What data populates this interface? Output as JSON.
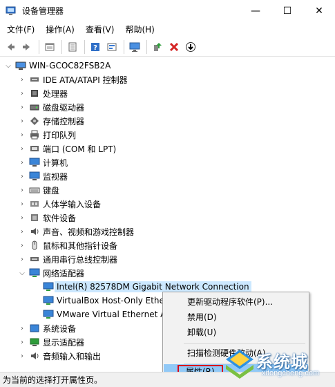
{
  "window": {
    "title": "设备管理器",
    "minimize": "—",
    "maximize": "☐",
    "close": "✕"
  },
  "menu": [
    "文件(F)",
    "操作(A)",
    "查看(V)",
    "帮助(H)"
  ],
  "toolbar": [
    "back-icon",
    "forward-icon",
    "sep",
    "view-icon",
    "sep",
    "properties-icon",
    "sep",
    "help-icon",
    "action-icon",
    "sep",
    "monitor-icon",
    "sep",
    "update-driver-icon",
    "remove-icon",
    "download-icon"
  ],
  "tree": {
    "root": "WIN-GCOC82FSB2A",
    "categories": [
      {
        "label": "IDE ATA/ATAPI 控制器",
        "icon": "ide-icon",
        "expanded": false
      },
      {
        "label": "处理器",
        "icon": "cpu-icon",
        "expanded": false
      },
      {
        "label": "磁盘驱动器",
        "icon": "disk-icon",
        "expanded": false
      },
      {
        "label": "存储控制器",
        "icon": "storage-icon",
        "expanded": false
      },
      {
        "label": "打印队列",
        "icon": "printer-icon",
        "expanded": false
      },
      {
        "label": "端口 (COM 和 LPT)",
        "icon": "port-icon",
        "expanded": false
      },
      {
        "label": "计算机",
        "icon": "computer-icon",
        "expanded": false
      },
      {
        "label": "监视器",
        "icon": "monitor-icon",
        "expanded": false
      },
      {
        "label": "键盘",
        "icon": "keyboard-icon",
        "expanded": false
      },
      {
        "label": "人体学输入设备",
        "icon": "hid-icon",
        "expanded": false
      },
      {
        "label": "软件设备",
        "icon": "software-icon",
        "expanded": false
      },
      {
        "label": "声音、视频和游戏控制器",
        "icon": "sound-icon",
        "expanded": false
      },
      {
        "label": "鼠标和其他指针设备",
        "icon": "mouse-icon",
        "expanded": false
      },
      {
        "label": "通用串行总线控制器",
        "icon": "usb-icon",
        "expanded": false
      },
      {
        "label": "网络适配器",
        "icon": "network-icon",
        "expanded": true
      }
    ],
    "network_children": [
      "Intel(R) 82578DM Gigabit Network Connection",
      "VirtualBox Host-Only Ethe",
      "VMware Virtual Ethernet A"
    ],
    "after": [
      {
        "label": "系统设备",
        "icon": "system-icon"
      },
      {
        "label": "显示适配器",
        "icon": "display-icon"
      },
      {
        "label": "音频输入和输出",
        "icon": "audio-icon"
      }
    ]
  },
  "context_menu": {
    "update": "更新驱动程序软件(P)...",
    "disable": "禁用(D)",
    "uninstall": "卸载(U)",
    "scan": "扫描检测硬件改动(A)",
    "properties": "属性(R)"
  },
  "status": "为当前的选择打开属性页。",
  "watermark": {
    "main": "系统城",
    "sub": "xitongcheng.com"
  },
  "colors": {
    "selected": "#cce8ff",
    "menu_highlight": "#91c9f7",
    "red_box": "#d9001b"
  }
}
